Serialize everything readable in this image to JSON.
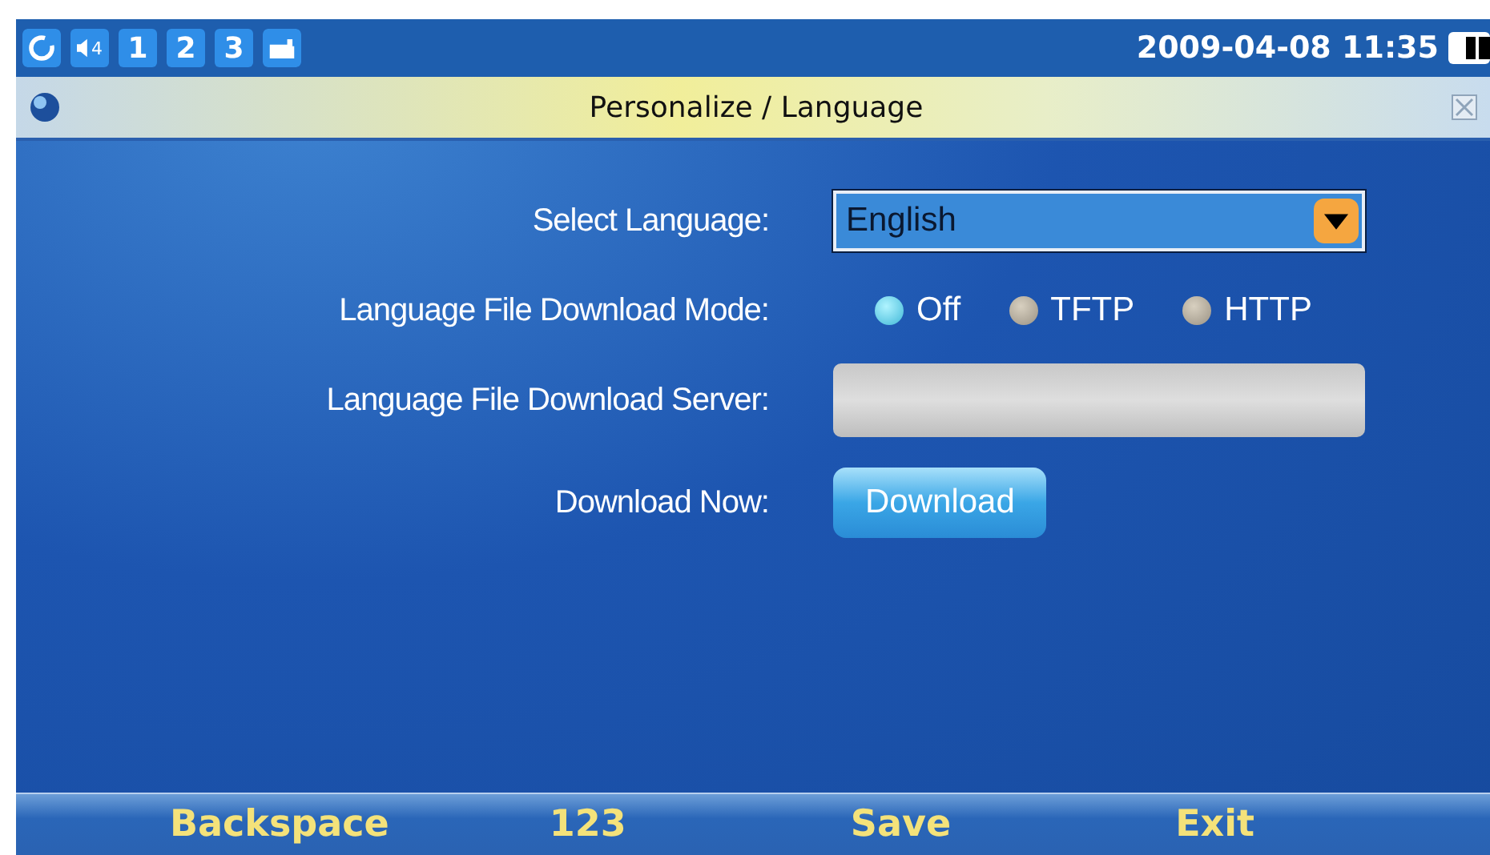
{
  "status_bar": {
    "volume": "4",
    "lines": [
      {
        "label": "1"
      },
      {
        "label": "2"
      },
      {
        "label": "3"
      }
    ],
    "datetime": "2009-04-08 11:35"
  },
  "window": {
    "title": "Personalize / Language"
  },
  "form": [
    {
      "kind": "dropdown",
      "label": "Select Language:",
      "value": "English"
    },
    {
      "kind": "radio",
      "label": "Language File Download Mode:",
      "options": [
        {
          "label": "Off",
          "selected": true
        },
        {
          "label": "TFTP",
          "selected": false
        },
        {
          "label": "HTTP",
          "selected": false
        }
      ]
    },
    {
      "kind": "input",
      "label": "Language File Download Server:"
    },
    {
      "kind": "button",
      "label": "Download Now:",
      "button": "Download"
    }
  ],
  "softkeys": [
    "Backspace",
    "123",
    "Save",
    "Exit"
  ]
}
